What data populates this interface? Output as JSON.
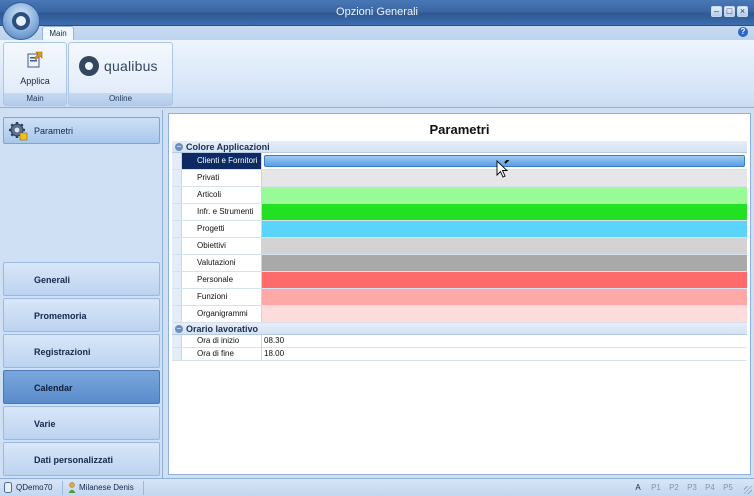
{
  "window": {
    "title": "Opzioni Generali"
  },
  "ribbon": {
    "tab": "Main",
    "groups": [
      {
        "label": "Main",
        "button": "Applica"
      },
      {
        "label": "Online",
        "logo_text": "qualibus"
      }
    ]
  },
  "sidebar": {
    "top_item": "Parametri",
    "nav": [
      "Generali",
      "Promemoria",
      "Registrazioni",
      "Calendar",
      "Varie",
      "Dati personalizzati"
    ],
    "active": "Calendar"
  },
  "main": {
    "title": "Parametri",
    "sections": [
      {
        "name": "Colore Applicazioni",
        "rows": [
          {
            "label": "Clienti e Fornitori",
            "color": "#7ab6ec",
            "selected": true
          },
          {
            "label": "Privati",
            "color": "#e6e6e6"
          },
          {
            "label": "Articoli",
            "color": "#98fb98"
          },
          {
            "label": "Infr. e Strumenti",
            "color": "#22e022"
          },
          {
            "label": "Progetti",
            "color": "#5ad4f8"
          },
          {
            "label": "Obiettivi",
            "color": "#d3d3d3"
          },
          {
            "label": "Valutazioni",
            "color": "#a9a9a9"
          },
          {
            "label": "Personale",
            "color": "#ff6a6a"
          },
          {
            "label": "Funzioni",
            "color": "#ffa8a8"
          },
          {
            "label": "Organigrammi",
            "color": "#ffdcdc"
          }
        ]
      },
      {
        "name": "Orario lavorativo",
        "rows": [
          {
            "label": "Ora di inizio",
            "value": "08.30"
          },
          {
            "label": "Ora di fine",
            "value": "18.00"
          }
        ]
      }
    ]
  },
  "status": {
    "database": "QDemo70",
    "user": "Milanese Denis",
    "indicators": [
      "A",
      "P1",
      "P2",
      "P3",
      "P4",
      "P5"
    ]
  },
  "icons": [
    "app-orb-icon",
    "minimize-icon",
    "maximize-icon",
    "close-icon",
    "help-icon",
    "applica-icon",
    "qualibus-logo-icon",
    "gear-icon",
    "database-icon",
    "user-icon",
    "mouse-cursor-icon"
  ]
}
